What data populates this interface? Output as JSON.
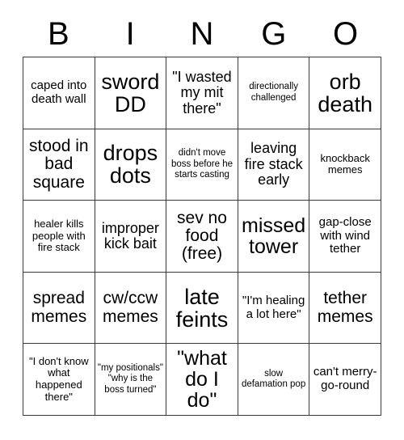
{
  "card": {
    "title_letters": [
      "B",
      "I",
      "N",
      "G",
      "O"
    ],
    "columns": 5,
    "rows": 5,
    "colors": {
      "background": "#ffffff",
      "text": "#000000",
      "grid_line": "#3a3a3a"
    },
    "cells": [
      {
        "text": "caped into death wall",
        "size": "sm",
        "free": false
      },
      {
        "text": "sword DD",
        "size": "xxl",
        "free": false
      },
      {
        "text": "\"I wasted my mit there\"",
        "size": "md",
        "free": false
      },
      {
        "text": "directionally challenged",
        "size": "xxs",
        "free": false
      },
      {
        "text": "orb death",
        "size": "xxl",
        "free": false
      },
      {
        "text": "stood in bad square",
        "size": "lg",
        "free": false
      },
      {
        "text": "drops dots",
        "size": "xxl",
        "free": false
      },
      {
        "text": "didn't move boss before he starts casting",
        "size": "xxs",
        "free": false
      },
      {
        "text": "leaving fire stack early",
        "size": "md",
        "free": false
      },
      {
        "text": "knockback memes",
        "size": "xs",
        "free": false
      },
      {
        "text": "healer kills people with fire stack",
        "size": "xs",
        "free": false
      },
      {
        "text": "improper kick bait",
        "size": "md",
        "free": false
      },
      {
        "text": "sev no food (free)",
        "size": "lg",
        "free": true
      },
      {
        "text": "missed tower",
        "size": "xl",
        "free": false
      },
      {
        "text": "gap-close with wind tether",
        "size": "sm",
        "free": false
      },
      {
        "text": "spread memes",
        "size": "lg",
        "free": false
      },
      {
        "text": "cw/ccw memes",
        "size": "lg",
        "free": false
      },
      {
        "text": "late feints",
        "size": "xxl",
        "free": false
      },
      {
        "text": "\"I'm healing a lot here\"",
        "size": "sm",
        "free": false
      },
      {
        "text": "tether memes",
        "size": "lg",
        "free": false
      },
      {
        "text": "\"I don't know what happened there\"",
        "size": "xs",
        "free": false
      },
      {
        "text": "\"my positionals\" \"why is the boss turned\"",
        "size": "xxs",
        "free": false
      },
      {
        "text": "\"what do I do\"",
        "size": "xl",
        "free": false
      },
      {
        "text": "slow defamation pop",
        "size": "xxs",
        "free": false
      },
      {
        "text": "can't merry-go-round",
        "size": "sm",
        "free": false
      }
    ]
  }
}
